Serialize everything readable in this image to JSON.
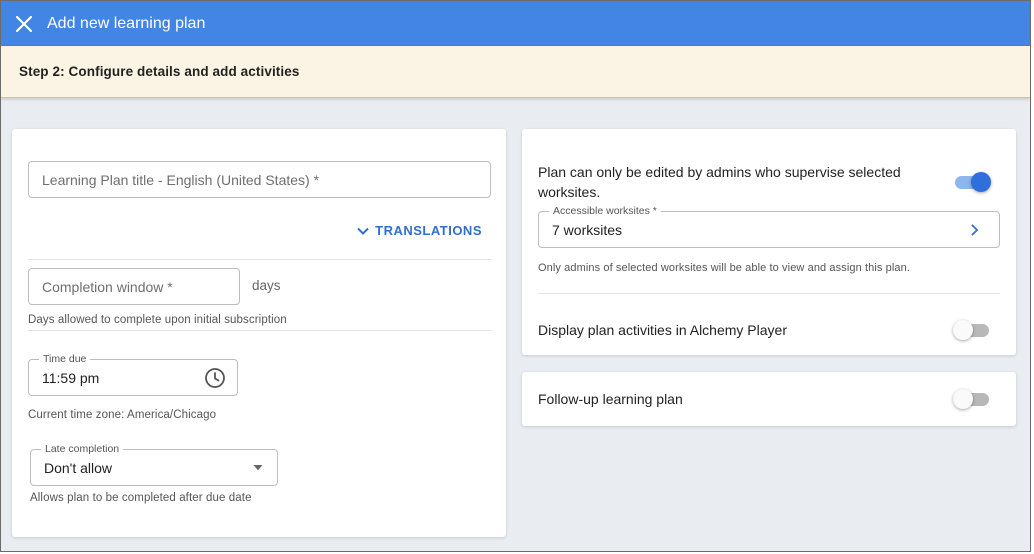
{
  "appbar": {
    "title": "Add new learning plan",
    "close_icon": "close-icon"
  },
  "step": {
    "label": "Step 2: Configure details and add activities"
  },
  "left": {
    "title_placeholder": "Learning Plan title - English (United States) *",
    "translations_label": "TRANSLATIONS",
    "completion_placeholder": "Completion window *",
    "completion_unit": "days",
    "completion_helper": "Days allowed to complete upon initial subscription",
    "time_due_label": "Time due",
    "time_due_value": "11:59 pm",
    "timezone_helper": "Current time zone: America/Chicago",
    "late_label": "Late completion",
    "late_value": "Don't allow",
    "late_helper": "Allows plan to be completed after due date"
  },
  "right": {
    "supervise_text": "Plan can only be edited by admins who supervise selected worksites.",
    "supervise_toggle": true,
    "worksites_label": "Accessible worksites *",
    "worksites_value": "7 worksites",
    "worksites_helper": "Only admins of selected worksites will be able to view and assign this plan.",
    "display_text": "Display plan activities in Alchemy Player",
    "display_toggle": false,
    "followup_text": "Follow-up learning plan",
    "followup_toggle": false
  },
  "colors": {
    "appbar": "#4285e4",
    "step_bg": "#fbf4e4",
    "accent": "#2f6fce",
    "page_bg": "#e9edf1"
  }
}
